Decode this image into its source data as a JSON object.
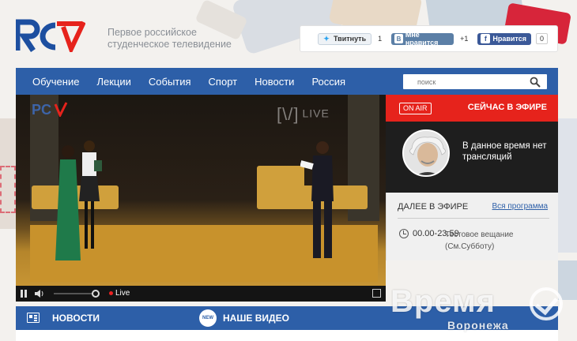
{
  "header": {
    "tagline": "Первое российское студенческое телевидение"
  },
  "social": {
    "twitter_label": "Твитнуть",
    "twitter_count": "1",
    "vk_label": "Мне нравится",
    "vk_count": "+1",
    "fb_label": "Нравится",
    "fb_count": "0"
  },
  "nav": {
    "items": [
      "Обучение",
      "Лекции",
      "События",
      "Спорт",
      "Новости",
      "Россия"
    ],
    "search_placeholder": "поиск"
  },
  "player": {
    "watermark": "LIVE",
    "live_label": "Live"
  },
  "onair": {
    "badge": "ON AIR",
    "title": "СЕЙЧАС В ЭФИРЕ",
    "current_text": "В данное время нет трансляций"
  },
  "next": {
    "title": "ДАЛЕЕ В ЭФИРЕ",
    "schedule_link": "Вся программа",
    "time": "00.00-23.59",
    "show": "Тестовое вещание (См.Субботу)"
  },
  "bottom": {
    "news_label": "НОВОСТИ",
    "video_badge": "NEW",
    "video_label": "НАШЕ ВИДЕО"
  },
  "watermark": {
    "big": "Время",
    "small": "Воронежа"
  },
  "colors": {
    "nav_blue": "#2d5fa8",
    "onair_red": "#e6231c",
    "logo_blue": "#1d4fa0",
    "logo_red": "#e6231c"
  }
}
